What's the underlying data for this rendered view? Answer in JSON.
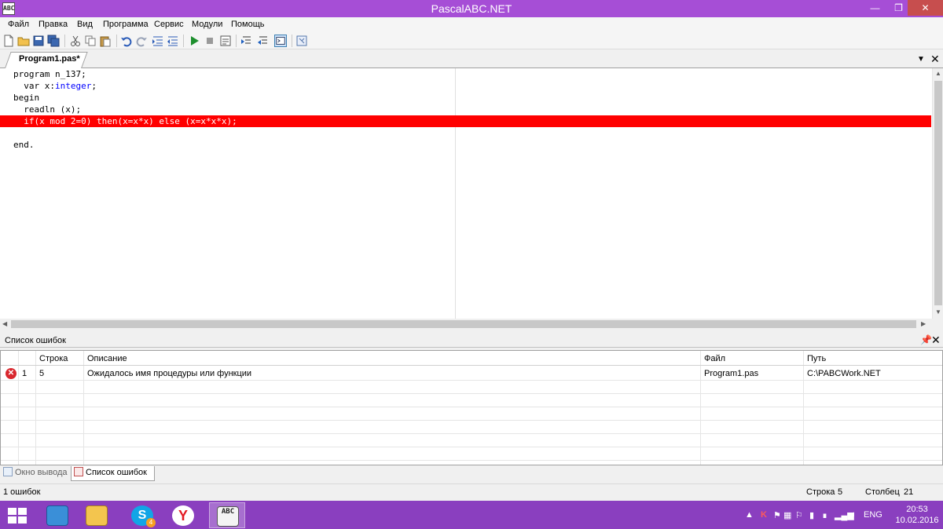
{
  "window": {
    "title": "PascalABC.NET",
    "app_icon_text": "ABC"
  },
  "menu": [
    "Файл",
    "Правка",
    "Вид",
    "Программа",
    "Сервис",
    "Модули",
    "Помощь"
  ],
  "tab": {
    "label": "Program1.pas*"
  },
  "editor": {
    "lines": [
      "program n_137;",
      "  var x:integer;",
      "begin",
      "  readln (x);",
      "  if(x mod 2=0) then(x=x*x) else (x=x*x*x);",
      "",
      "end."
    ],
    "error_line_index": 4
  },
  "error_panel": {
    "title": "Список ошибок",
    "columns": [
      "Строка",
      "Описание",
      "Файл",
      "Путь"
    ],
    "rows": [
      {
        "num": "1",
        "line": "5",
        "description": "Ожидалось имя процедуры или функции",
        "file": "Program1.pas",
        "path": "C:\\PABCWork.NET"
      }
    ]
  },
  "bottom_tabs": [
    "Окно вывода",
    "Список ошибок"
  ],
  "status": {
    "errors": "1 ошибок",
    "line_label": "Строка",
    "line_value": "5",
    "col_label": "Столбец",
    "col_value": "21"
  },
  "taskbar": {
    "lang": "ENG",
    "time": "20:53",
    "date": "10.02.2016",
    "skype_badge": "4"
  },
  "colors": {
    "titlebar": "#a64ed6",
    "taskbar": "#8a3fbf",
    "error_line": "#ff0000",
    "keyword": "#0000ff"
  }
}
